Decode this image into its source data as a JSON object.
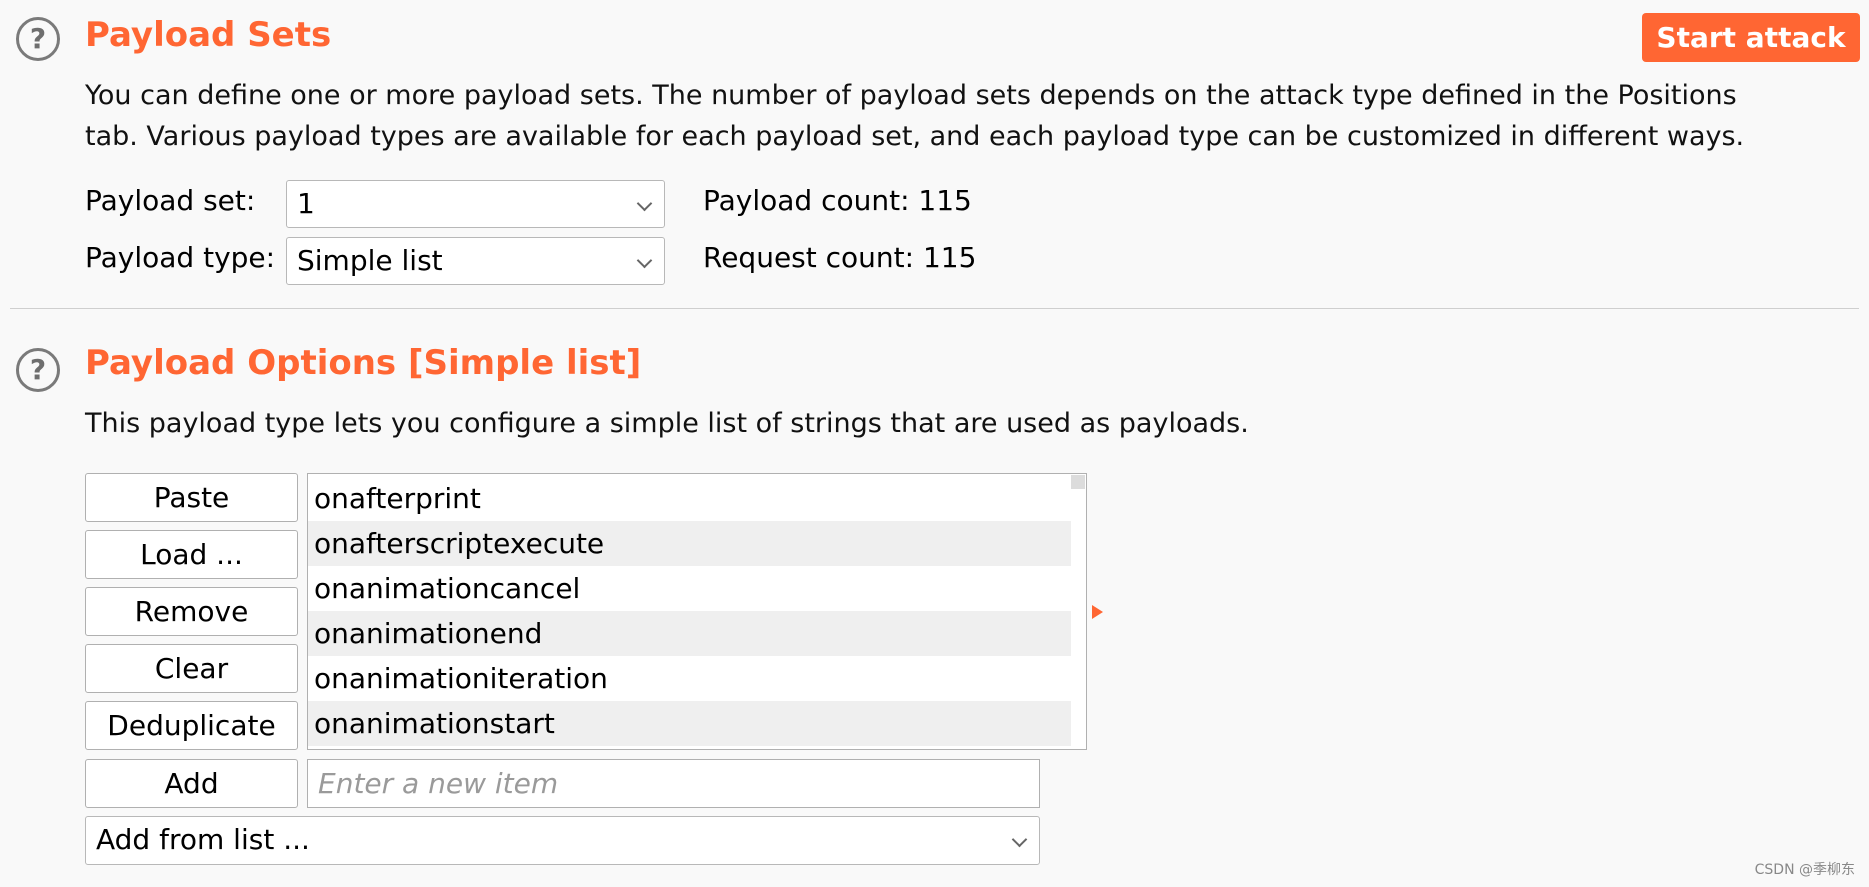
{
  "payload_sets": {
    "title": "Payload Sets",
    "description_line1": "You can define one or more payload sets. The number of payload sets depends on the attack type defined in the Positions",
    "description_line2": "tab. Various payload types are available for each payload set, and each payload type can be customized in different ways.",
    "set_label": "Payload set:",
    "set_value": "1",
    "type_label": "Payload type:",
    "type_value": "Simple list",
    "payload_count": "Payload count: 115",
    "request_count": "Request count: 115"
  },
  "start_attack_label": "Start attack",
  "payload_options": {
    "title": "Payload Options [Simple list]",
    "description": "This payload type lets you configure a simple list of strings that are used as payloads.",
    "buttons": {
      "paste": "Paste",
      "load": "Load ...",
      "remove": "Remove",
      "clear": "Clear",
      "deduplicate": "Deduplicate",
      "add": "Add"
    },
    "list_items": [
      "onafterprint",
      "onafterscriptexecute",
      "onanimationcancel",
      "onanimationend",
      "onanimationiteration",
      "onanimationstart"
    ],
    "add_placeholder": "Enter a new item",
    "add_from_list": "Add from list ..."
  },
  "icons": {
    "help": "?"
  },
  "colors": {
    "accent": "#ff6633",
    "background": "#f9f9f9",
    "row_alt": "#efefef"
  },
  "watermark": "CSDN @季柳东"
}
